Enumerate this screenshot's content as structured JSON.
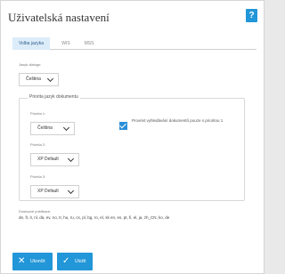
{
  "dialog": {
    "title": "Uživatelská nastavení",
    "help_label": "?"
  },
  "tabs": [
    {
      "label": "Volba jazyka"
    },
    {
      "label": "WIS"
    },
    {
      "label": "MSS"
    }
  ],
  "dialog_language": {
    "label": "Jazyk dialogu:",
    "value": "Čeština"
  },
  "doc_priority": {
    "legend": "Priorita jazyk dokumentu",
    "p1": {
      "label": "Priorita 1:",
      "value": "Čeština"
    },
    "p2": {
      "label": "Priorita 2:",
      "value": "XP Default"
    },
    "p3": {
      "label": "Priorita 3:",
      "value": "XP Default"
    },
    "checkbox_label": "Provést vyhledávání dokumentů pouze s prioritou 1",
    "checkbox_checked": true
  },
  "publications": {
    "label": "Dostupné publikace:",
    "list": "de, fr, it, nl, da, ev, no, tr, hu, ru, cs, pl, bg, ro, el, sk en, es, pt, fi, el, ja, zh_CN, ko, de"
  },
  "buttons": {
    "close": "Ukončit",
    "save": "Uložit"
  },
  "colors": {
    "accent": "#2196d8",
    "tab_active_bg": "#dcecf9"
  }
}
